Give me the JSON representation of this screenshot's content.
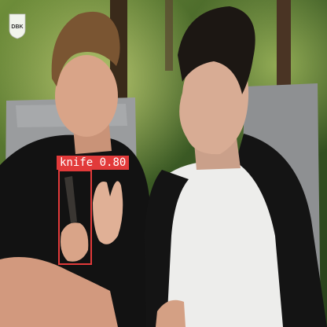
{
  "watermark": {
    "text": "DBK"
  },
  "detections": [
    {
      "class": "knife",
      "score": "0.80",
      "color": "#e23a3a"
    }
  ],
  "colors": {
    "foliage_dark": "#2f4a1f",
    "foliage_light": "#8fa848",
    "chair": "#9c9ea0",
    "shirt_black": "#121212",
    "shirt_white": "#ededeb",
    "skin": "#d9a488",
    "hair_brown": "#7a5532",
    "hair_black": "#1c1713"
  }
}
